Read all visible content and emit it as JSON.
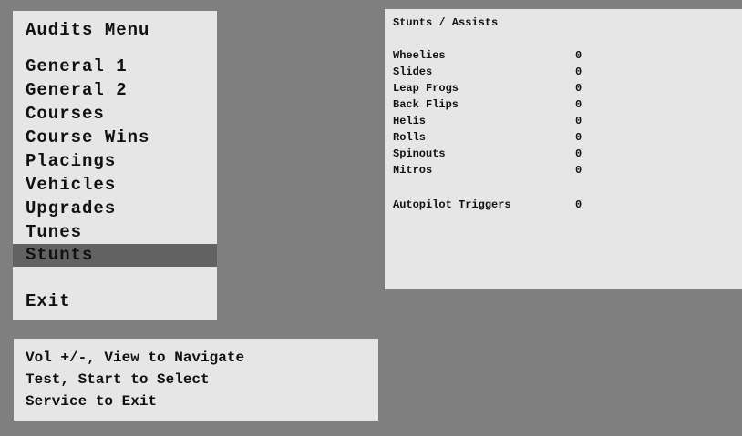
{
  "menu": {
    "title": "Audits Menu",
    "items": [
      "General 1",
      "General 2",
      "Courses",
      "Course Wins",
      "Placings",
      "Vehicles",
      "Upgrades",
      "Tunes"
    ],
    "selected": "Stunts",
    "exit": "Exit"
  },
  "help": {
    "lines": [
      "Vol +/-, View to Navigate",
      "Test, Start to Select",
      "Service to Exit"
    ]
  },
  "stunts": {
    "title": "Stunts / Assists",
    "rows": [
      {
        "label": "Wheelies",
        "value": "0"
      },
      {
        "label": "Slides",
        "value": "0"
      },
      {
        "label": "Leap Frogs",
        "value": "0"
      },
      {
        "label": "Back Flips",
        "value": "0"
      },
      {
        "label": "Helis",
        "value": "0"
      },
      {
        "label": "Rolls",
        "value": "0"
      },
      {
        "label": "Spinouts",
        "value": "0"
      },
      {
        "label": "Nitros",
        "value": "0"
      }
    ],
    "autopilot": {
      "label": "Autopilot Triggers",
      "value": "0"
    }
  }
}
